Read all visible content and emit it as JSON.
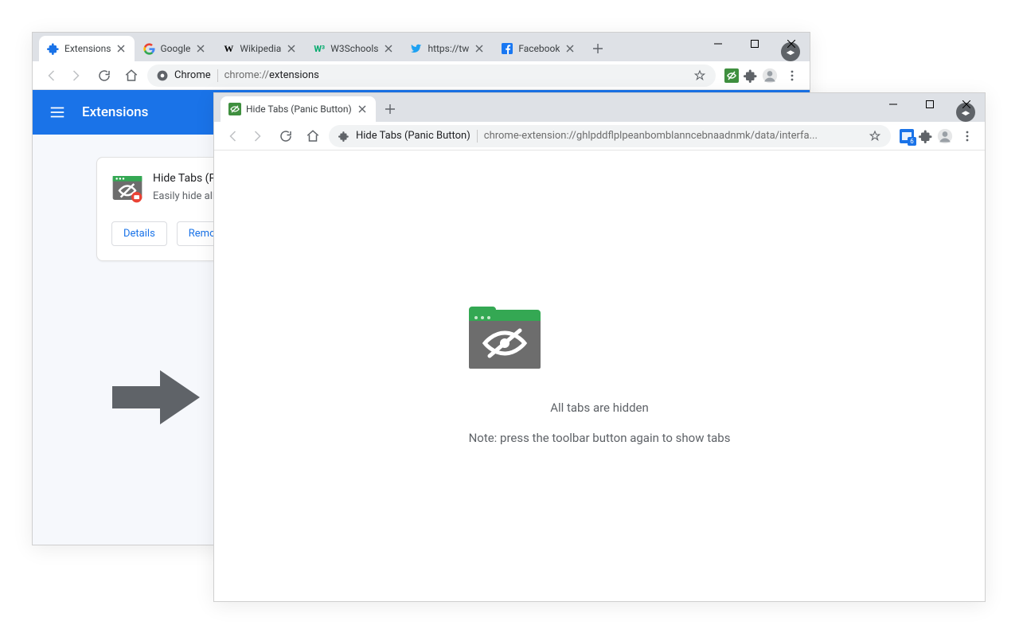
{
  "window1": {
    "tabs": [
      {
        "title": "Extensions",
        "icon": "puzzle-blue"
      },
      {
        "title": "Google",
        "icon": "google"
      },
      {
        "title": "Wikipedia",
        "icon": "wikipedia"
      },
      {
        "title": "W3Schools",
        "icon": "w3"
      },
      {
        "title": "https://tw",
        "icon": "twitter"
      },
      {
        "title": "Facebook",
        "icon": "facebook"
      }
    ],
    "address": {
      "prefix": "Chrome",
      "url_gray": "chrome://",
      "url_bold": "extensions"
    },
    "bluebar_title": "Extensions",
    "card": {
      "name": "Hide Tabs (Panic Button)",
      "desc": "Easily hide all tabs with the click of a button.",
      "details": "Details",
      "remove": "Remove"
    }
  },
  "window2": {
    "tab_title": "Hide Tabs (Panic Button)",
    "address": {
      "prefix": "Hide Tabs (Panic Button)",
      "url": "chrome-extension://ghlpddflplpeanbomblanncebnaadnmk/data/interfa..."
    },
    "msg1": "All tabs are hidden",
    "msg2": "Note: press the toolbar button again to show tabs",
    "badge_count": "6"
  }
}
